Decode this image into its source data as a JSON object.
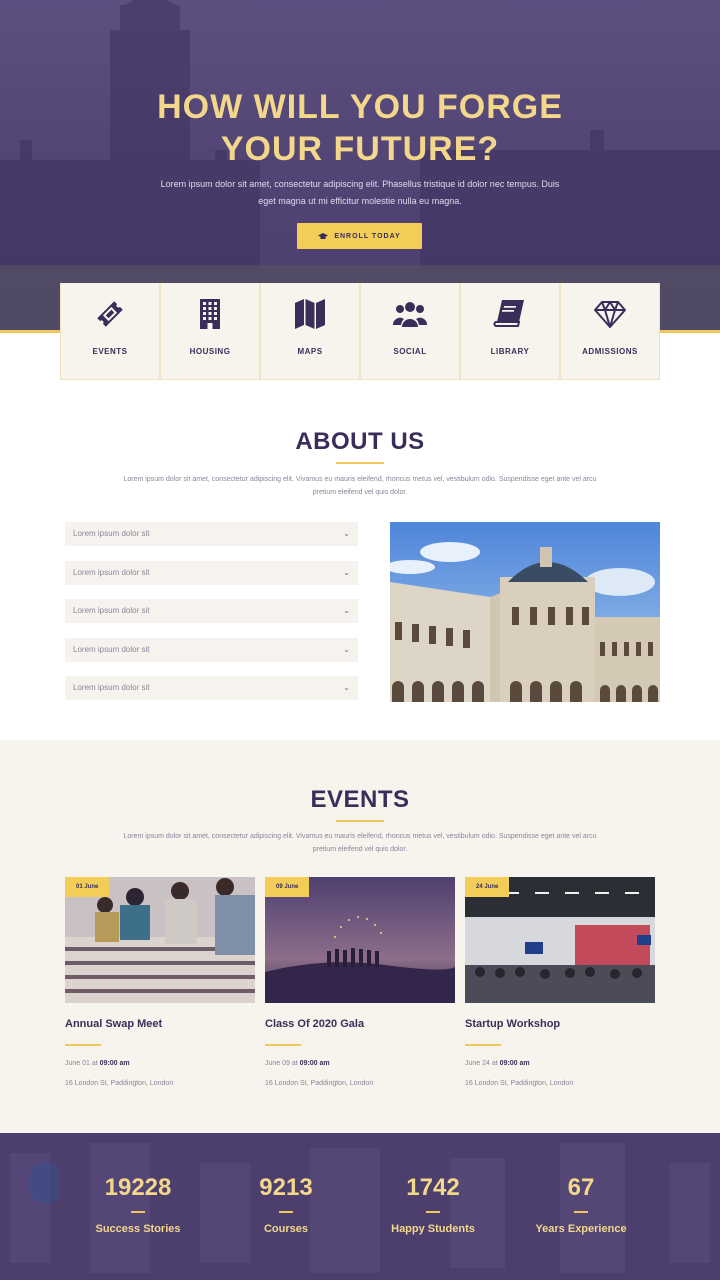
{
  "hero": {
    "title": "HOW WILL YOU FORGE\nYOUR FUTURE?",
    "subtitle": "Lorem ipsum dolor sit amet, consectetur adipiscing elit. Phasellus tristique id dolor nec tempus. Duis eget magna ut mi efficitur molestie nulla eu magna.",
    "enroll_label": "ENROLL TODAY"
  },
  "icon_cards": [
    {
      "label": "EVENTS",
      "icon": "ticket-icon"
    },
    {
      "label": "HOUSING",
      "icon": "building-icon"
    },
    {
      "label": "MAPS",
      "icon": "map-icon"
    },
    {
      "label": "SOCIAL",
      "icon": "users-icon"
    },
    {
      "label": "LIBRARY",
      "icon": "book-icon"
    },
    {
      "label": "ADMISSIONS",
      "icon": "diamond-icon"
    }
  ],
  "about": {
    "title": "ABOUT US",
    "subtitle": "Lorem ipsum dolor sit amet, consectetur adipiscing elit. Vivamus eu mauris eleifend, rhoncus metus vel, vestibulum odio. Suspendisse eget ante vel arcu pretium eleifend vel quis dolor.",
    "accordion": [
      "Lorem ipsum dolor sit",
      "Lorem ipsum dolor sit",
      "Lorem ipsum dolor sit",
      "Lorem ipsum dolor sit",
      "Lorem ipsum dolor sit"
    ]
  },
  "events": {
    "title": "EVENTS",
    "subtitle": "Lorem ipsum dolor sit amet, consectetur adipiscing elit. Vivamus eu mauris eleifend, rhoncus metus vel, vestibulum odio. Suspendisse eget ante vel arcu pretium eleifend vel quis dolor.",
    "items": [
      {
        "tag": "01 June",
        "title": "Annual Swap Meet",
        "date": "June 01",
        "at": "at",
        "time": "09:00 am",
        "address": "16 London St, Paddington, London"
      },
      {
        "tag": "09 June",
        "title": "Class Of 2020 Gala",
        "date": "June 09",
        "at": "at",
        "time": "09:00 am",
        "address": "16 London St, Paddington, London"
      },
      {
        "tag": "24 June",
        "title": "Startup Workshop",
        "date": "June 24",
        "at": "at",
        "time": "09:00 am",
        "address": "16 London St, Paddington, London"
      }
    ]
  },
  "stats": [
    {
      "number": "19228",
      "label": "Success Stories"
    },
    {
      "number": "9213",
      "label": "Courses"
    },
    {
      "number": "1742",
      "label": "Happy Students"
    },
    {
      "number": "67",
      "label": "Years Experience"
    }
  ],
  "colors": {
    "primary": "#3b2d5a",
    "accent": "#f2cd58",
    "light_bg": "#f7f4ee"
  }
}
